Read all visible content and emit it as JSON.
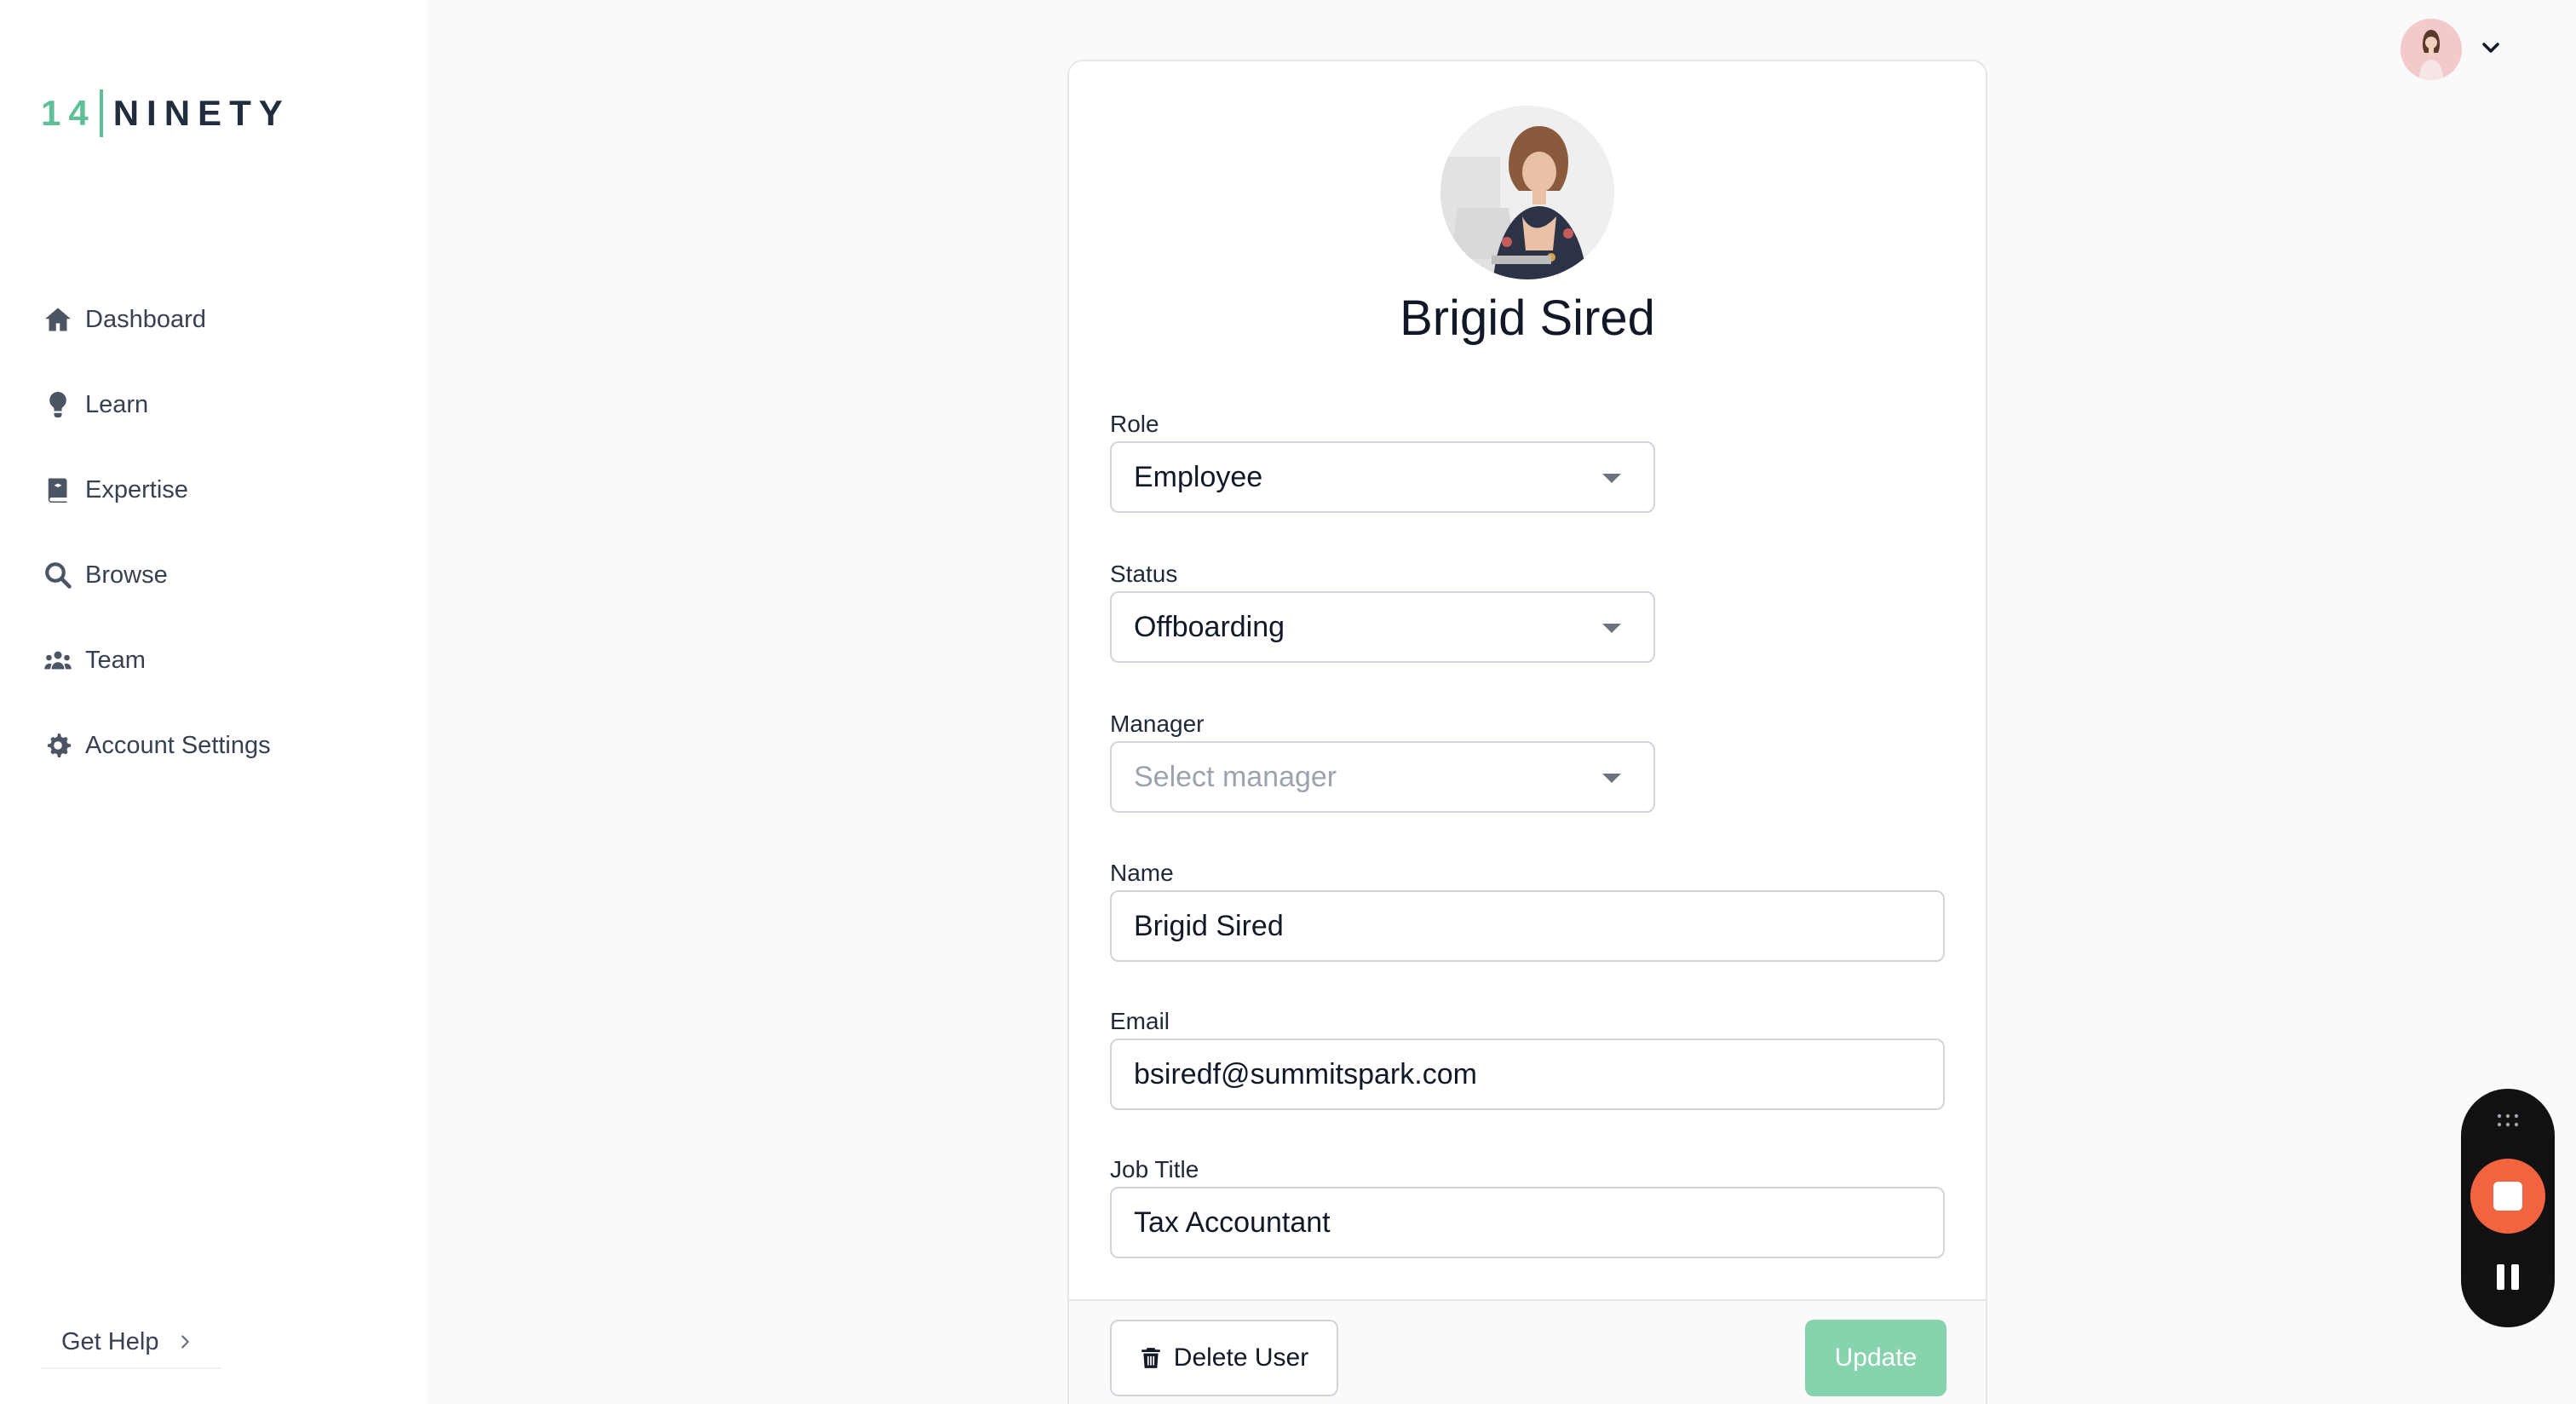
{
  "brand": {
    "logo_number": "14",
    "logo_word": "NINETY"
  },
  "sidebar": {
    "items": [
      {
        "label": "Dashboard",
        "icon": "home-icon"
      },
      {
        "label": "Learn",
        "icon": "lightbulb-icon"
      },
      {
        "label": "Expertise",
        "icon": "book-icon"
      },
      {
        "label": "Browse",
        "icon": "search-icon"
      },
      {
        "label": "Team",
        "icon": "team-icon"
      },
      {
        "label": "Account Settings",
        "icon": "gear-icon"
      }
    ],
    "get_help": "Get Help"
  },
  "profile": {
    "name": "Brigid Sired"
  },
  "form": {
    "role": {
      "label": "Role",
      "value": "Employee"
    },
    "status": {
      "label": "Status",
      "value": "Offboarding"
    },
    "manager": {
      "label": "Manager",
      "placeholder": "Select manager"
    },
    "name": {
      "label": "Name",
      "value": "Brigid Sired"
    },
    "email": {
      "label": "Email",
      "value": "bsiredf@summitspark.com"
    },
    "job_title": {
      "label": "Job Title",
      "value": "Tax Accountant"
    }
  },
  "actions": {
    "delete_label": "Delete User",
    "update_label": "Update"
  },
  "colors": {
    "brand_green": "#5fbf97",
    "update_button": "#86d3ae",
    "recorder_stop": "#f2643f"
  }
}
